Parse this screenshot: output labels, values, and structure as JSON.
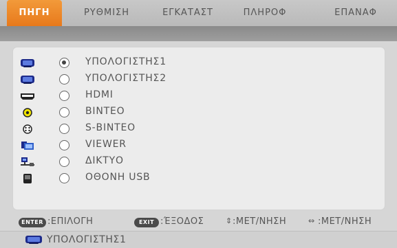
{
  "tabs": [
    {
      "label": "ΠΗΓΗ",
      "active": true
    },
    {
      "label": "ΡΥΘΜΙΣΗ",
      "active": false
    },
    {
      "label": "ΕΓΚΑΤΑΣΤ",
      "active": false
    },
    {
      "label": "ΠΛΗΡΟΦ",
      "active": false
    },
    {
      "label": "ΕΠΑΝΑΦ",
      "active": false
    }
  ],
  "sources": [
    {
      "label": "ΥΠΟΛΟΓΙΣΤΗΣ1",
      "icon": "computer-vga-icon",
      "selected": true
    },
    {
      "label": "ΥΠΟΛΟΓΙΣΤΗΣ2",
      "icon": "computer-vga-icon",
      "selected": false
    },
    {
      "label": "HDMI",
      "icon": "hdmi-icon",
      "selected": false
    },
    {
      "label": "ΒΙΝΤΕΟ",
      "icon": "video-rca-icon",
      "selected": false
    },
    {
      "label": "S-ΒΙΝΤΕΟ",
      "icon": "s-video-icon",
      "selected": false
    },
    {
      "label": "VIEWER",
      "icon": "viewer-icon",
      "selected": false
    },
    {
      "label": "ΔΙΚΤΥΟ",
      "icon": "network-icon",
      "selected": false
    },
    {
      "label": "ΟΘΟΝΗ USB",
      "icon": "usb-display-icon",
      "selected": false
    }
  ],
  "footer": {
    "enter_key": "ENTER",
    "enter_text": ":ΕΠΙΛΟΓΗ",
    "exit_key": "EXIT",
    "exit_text": ":ΈΞΟΔΟΣ",
    "updown_text": ":ΜΕΤ/ΝΗΣΗ",
    "leftright_text": ":ΜΕΤ/ΝΗΣΗ"
  },
  "status": {
    "current_source": "ΥΠΟΛΟΓΙΣΤΗΣ1",
    "icon": "computer-vga-icon"
  },
  "colors": {
    "active_tab": "#e8791b",
    "icon_blue": "#1c2a8a",
    "video_yellow": "#f2e600"
  }
}
